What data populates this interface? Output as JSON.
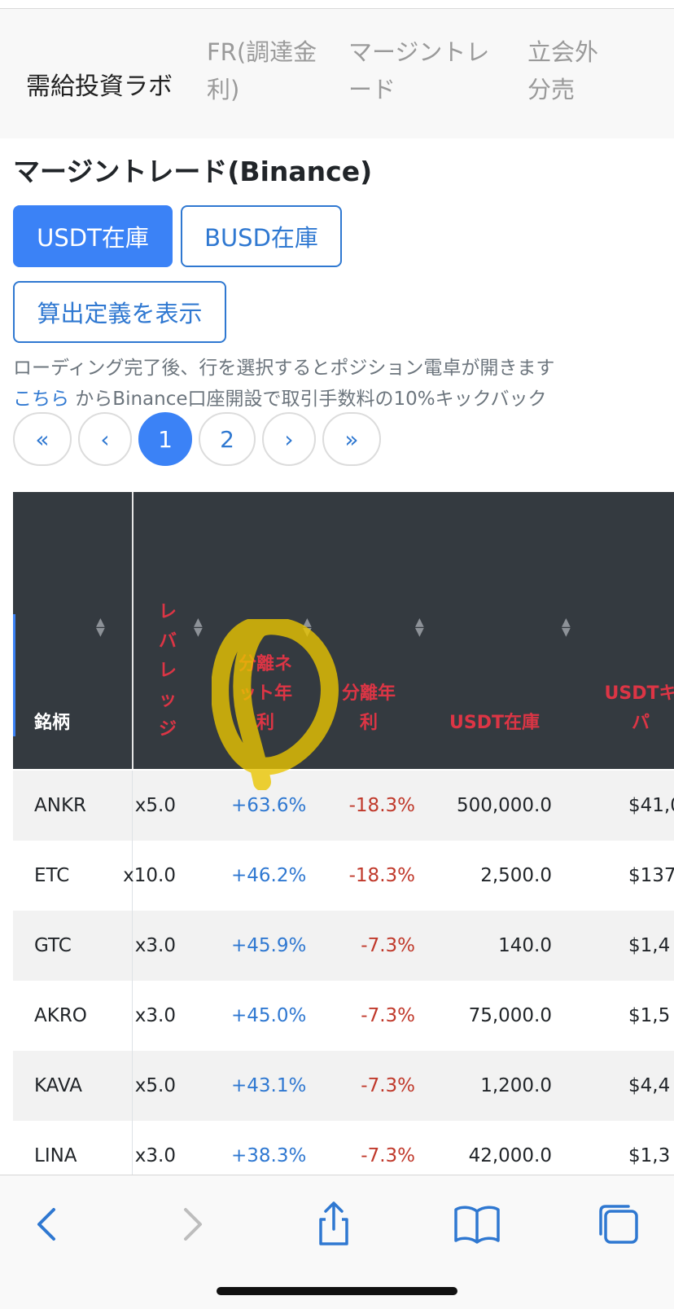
{
  "nav": {
    "brand": "需給投資ラボ",
    "links": [
      {
        "line1": "FR(調達金",
        "line2": "利)"
      },
      {
        "line1": "マージントレ",
        "line2": "ード"
      },
      {
        "line1": "立会外",
        "line2": "分売"
      }
    ]
  },
  "page_title": "マージントレード(Binance)",
  "buttons": {
    "usdt": "USDT在庫",
    "busd": "BUSD在庫",
    "definition": "算出定義を表示"
  },
  "notes": {
    "loading": "ローディング完了後、行を選択するとポジション電卓が開きます",
    "link": "こちら",
    "referral": " からBinance口座開設で取引手数料の10%キックバック"
  },
  "pagination": {
    "first": "«",
    "prev": "‹",
    "pages": [
      "1",
      "2"
    ],
    "next": "›",
    "last": "»",
    "current": "1"
  },
  "table": {
    "headers": {
      "symbol": "銘柄",
      "leverage": [
        "レ",
        "バ",
        "レ",
        "ッ",
        "ジ"
      ],
      "net_rate": [
        "分離ネ",
        "ット年",
        "利"
      ],
      "annual_rate": [
        "分離年",
        "利"
      ],
      "stock": "USDT在庫",
      "usdt_cap": [
        "USDTキ",
        "パ"
      ]
    },
    "rows": [
      {
        "symbol": "ANKR",
        "leverage": "x5.0",
        "net": "+63.6%",
        "annual": "-18.3%",
        "stock": "500,000.0",
        "usd": "$41,0"
      },
      {
        "symbol": "ETC",
        "leverage": "x10.0",
        "net": "+46.2%",
        "annual": "-18.3%",
        "stock": "2,500.0",
        "usd": "$137,3"
      },
      {
        "symbol": "GTC",
        "leverage": "x3.0",
        "net": "+45.9%",
        "annual": "-7.3%",
        "stock": "140.0",
        "usd": "$1,4"
      },
      {
        "symbol": "AKRO",
        "leverage": "x3.0",
        "net": "+45.0%",
        "annual": "-7.3%",
        "stock": "75,000.0",
        "usd": "$1,5"
      },
      {
        "symbol": "KAVA",
        "leverage": "x5.0",
        "net": "+43.1%",
        "annual": "-7.3%",
        "stock": "1,200.0",
        "usd": "$4,4"
      },
      {
        "symbol": "LINA",
        "leverage": "x3.0",
        "net": "+38.3%",
        "annual": "-7.3%",
        "stock": "42,000.0",
        "usd": "$1,3"
      }
    ]
  },
  "toolbar": {
    "icons": [
      "back-icon",
      "forward-icon",
      "share-icon",
      "bookmarks-icon",
      "tabs-icon"
    ]
  },
  "colors": {
    "accent": "#3b82f6",
    "link": "#2f78d1",
    "negative": "#c0392b",
    "header_bg": "#343a40",
    "highlight": "#e8c400"
  }
}
